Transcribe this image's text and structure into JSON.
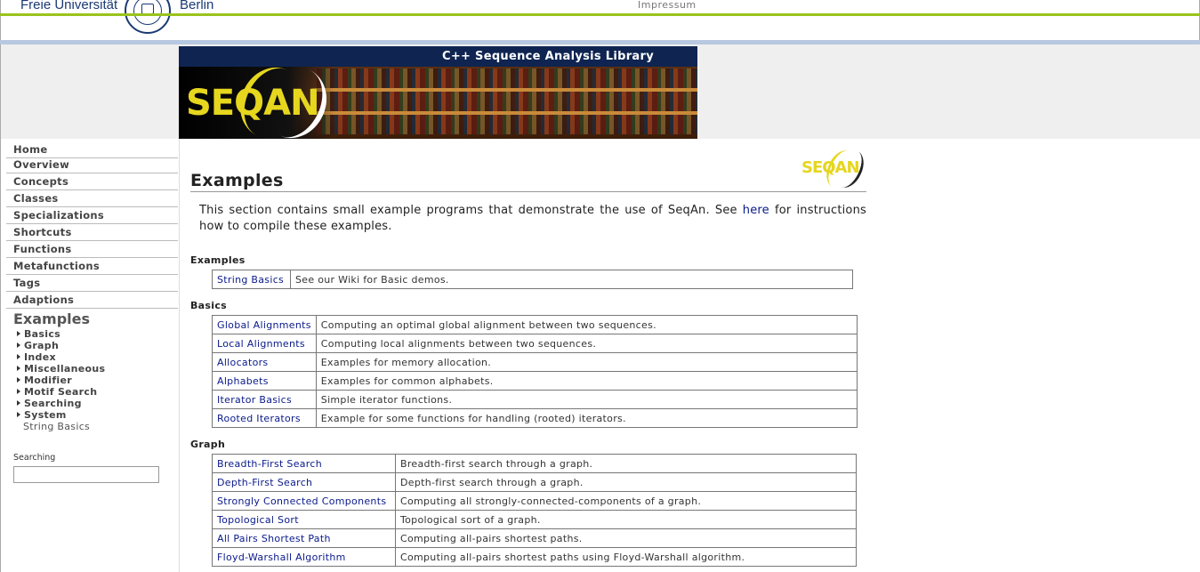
{
  "header": {
    "university_left": "Freie Universität",
    "university_right": "Berlin",
    "impressum": "Impressum"
  },
  "banner": {
    "title": "C++ Sequence Analysis Library",
    "logo_text": "SEQAN"
  },
  "sidebar": {
    "nav": [
      "Home",
      "Overview",
      "Concepts",
      "Classes",
      "Specializations",
      "Shortcuts",
      "Functions",
      "Metafunctions",
      "Tags",
      "Adaptions"
    ],
    "current": "Examples",
    "sub_items": [
      "Basics",
      "Graph",
      "Index",
      "Miscellaneous",
      "Modifier",
      "Motif Search",
      "Searching",
      "System"
    ],
    "current_sub": "String Basics",
    "search_label": "Searching",
    "search_value": ""
  },
  "main": {
    "title": "Examples",
    "small_logo_text": "SEQAN",
    "intro_before": "This section contains small example programs that demonstrate the use of SeqAn. See ",
    "intro_link": "here",
    "intro_after": " for instructions how to compile these examples.",
    "sections": [
      {
        "heading": "Examples",
        "rows": [
          {
            "name": "String Basics",
            "desc": "See our Wiki for Basic demos."
          }
        ]
      },
      {
        "heading": "Basics",
        "rows": [
          {
            "name": "Global Alignments",
            "desc": "Computing an optimal global alignment between two sequences."
          },
          {
            "name": "Local Alignments",
            "desc": "Computing local alignments between two sequences."
          },
          {
            "name": "Allocators",
            "desc": "Examples for memory allocation."
          },
          {
            "name": "Alphabets",
            "desc": "Examples for common alphabets."
          },
          {
            "name": "Iterator Basics",
            "desc": "Simple iterator functions."
          },
          {
            "name": "Rooted Iterators",
            "desc": "Example for some functions for handling (rooted) iterators."
          }
        ]
      },
      {
        "heading": "Graph",
        "rows": [
          {
            "name": "Breadth-First Search",
            "desc": "Breadth-first search through a graph."
          },
          {
            "name": "Depth-First Search",
            "desc": "Depth-first search through a graph."
          },
          {
            "name": "Strongly Connected Components",
            "desc": "Computing all strongly-connected-components of a graph."
          },
          {
            "name": "Topological Sort",
            "desc": "Topological sort of a graph."
          },
          {
            "name": "All Pairs Shortest Path",
            "desc": "Computing all-pairs shortest paths."
          },
          {
            "name": "Floyd-Warshall Algorithm",
            "desc": "Computing all-pairs shortest paths using Floyd-Warshall algorithm."
          }
        ]
      }
    ]
  }
}
